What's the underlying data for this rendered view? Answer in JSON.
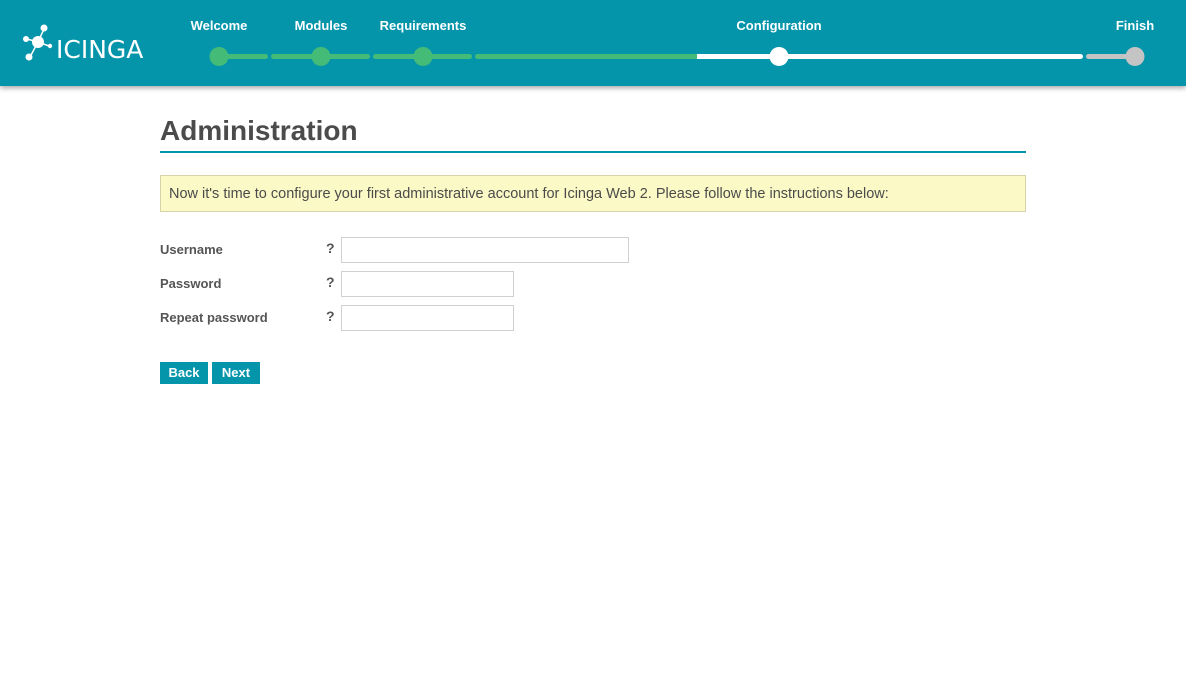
{
  "header": {
    "brand": "ICINGA",
    "colors": {
      "bar": "#0595ab",
      "done": "#44bb77",
      "current": "#ffffff",
      "future": "#c4c4c4"
    },
    "steps": [
      {
        "label": "Welcome",
        "state": "done"
      },
      {
        "label": "Modules",
        "state": "done"
      },
      {
        "label": "Requirements",
        "state": "done"
      },
      {
        "label": "Configuration",
        "state": "current"
      },
      {
        "label": "Finish",
        "state": "future"
      }
    ]
  },
  "main": {
    "title": "Administration",
    "notice": "Now it's time to configure your first administrative account for Icinga Web 2. Please follow the instructions below:",
    "form": {
      "username": {
        "label": "Username",
        "help": "?",
        "value": ""
      },
      "password": {
        "label": "Password",
        "help": "?",
        "value": ""
      },
      "repeat_password": {
        "label": "Repeat password",
        "help": "?",
        "value": ""
      }
    },
    "buttons": {
      "back": "Back",
      "next": "Next"
    }
  }
}
